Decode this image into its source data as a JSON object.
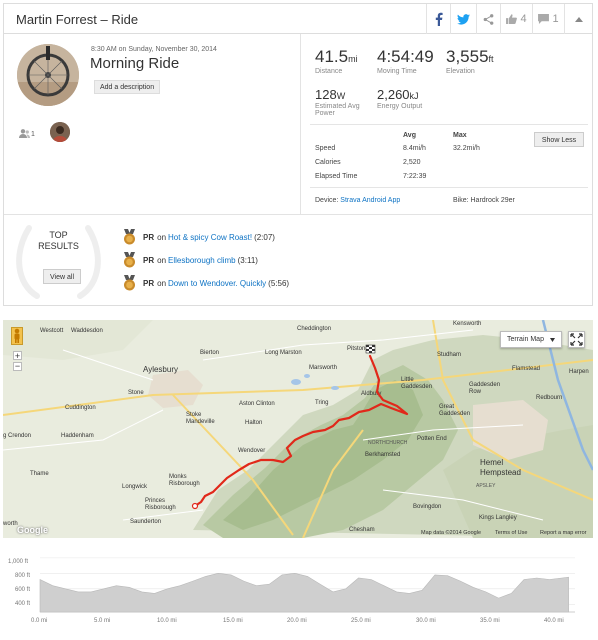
{
  "header": {
    "title": "Martin Forrest – Ride",
    "likes": "4",
    "comments": "1"
  },
  "activity": {
    "date": "8:30 AM on Sunday, November 30, 2014",
    "name": "Morning Ride",
    "add_description": "Add a description",
    "athlete_count": "1"
  },
  "stats": {
    "distance_value": "41.5",
    "distance_unit": "mi",
    "distance_label": "Distance",
    "moving_time_value": "4:54:49",
    "moving_time_label": "Moving Time",
    "elevation_value": "3,555",
    "elevation_unit": "ft",
    "elevation_label": "Elevation",
    "power_value": "128",
    "power_unit": "W",
    "power_label_1": "Estimated Avg",
    "power_label_2": "Power",
    "energy_value": "2,260",
    "energy_unit": "kJ",
    "energy_label": "Energy Output"
  },
  "details": {
    "col_avg": "Avg",
    "col_max": "Max",
    "rows": [
      {
        "label": "Speed",
        "avg": "8.4mi/h",
        "max": "32.2mi/h"
      },
      {
        "label": "Calories",
        "avg": "2,520",
        "max": ""
      },
      {
        "label": "Elapsed Time",
        "avg": "7:22:39",
        "max": ""
      }
    ],
    "show_less": "Show Less",
    "device_label": "Device:",
    "device_value": "Strava Android App",
    "bike": "Bike: Hardrock 29er"
  },
  "top_results": {
    "title_1": "TOP",
    "title_2": "RESULTS",
    "view_all": "View all",
    "items": [
      {
        "pr": "PR",
        "on": "on",
        "segment": "Hot & spicy Cow Roast!",
        "time": "(2:07)"
      },
      {
        "pr": "PR",
        "on": "on",
        "segment": "Ellesborough climb",
        "time": "(3:11)"
      },
      {
        "pr": "PR",
        "on": "on",
        "segment": "Down to Wendover. Quickly",
        "time": "(5:56)"
      }
    ]
  },
  "map": {
    "map_type": "Terrain Map",
    "places": {
      "westcott": "Westcott",
      "waddesdon": "Waddesdon",
      "cheddington": "Cheddington",
      "kensworth": "Kensworth",
      "bierton": "Bierton",
      "long_marston": "Long Marston",
      "pitstone": "Pitstone",
      "studham": "Studham",
      "aylesbury": "Aylesbury",
      "marsworth": "Marsworth",
      "little_gaddesden": "Little Gaddesden",
      "flamstead": "Flamstead",
      "harpenden": "Harpen",
      "stone": "Stone",
      "aston_clinton": "Aston Clinton",
      "tring": "Tring",
      "aldbury": "Aldbury",
      "gaddesden_row": "Gaddesden Row",
      "redbourn": "Redbourn",
      "cuddington": "Cuddington",
      "stoke_mandeville": "Stoke Mandeville",
      "great_gaddesden": "Great Gaddesden",
      "long_crendon": "g Crendon",
      "haddenham": "Haddenham",
      "halton": "Halton",
      "northchurch": "NORTHCHURCH",
      "potten_end": "Potten End",
      "wendover": "Wendover",
      "berkhamsted": "Berkhamsted",
      "hemel": "Hemel Hempstead",
      "thame": "Thame",
      "apsley": "APSLEY",
      "monks_risborough": "Monks Risborough",
      "longwick": "Longwick",
      "princes_risborough": "Princes Risborough",
      "bovingdon": "Bovingdon",
      "saunderton": "Saunderton",
      "chesham": "Chesham",
      "kings_langley": "Kings Langley",
      "tetsworth": "worth"
    },
    "google_logo": "Google",
    "map_data": "Map data ©2014 Google",
    "terms": "Terms of Use",
    "report": "Report a map error"
  },
  "elevation": {
    "y_ticks": [
      "1,000 ft",
      "800 ft",
      "600 ft",
      "400 ft"
    ],
    "x_ticks": [
      "0.0 mi",
      "5.0 mi",
      "10.0 mi",
      "15.0 mi",
      "20.0 mi",
      "25.0 mi",
      "30.0 mi",
      "35.0 mi",
      "40.0 mi"
    ]
  },
  "chart_data": {
    "type": "area",
    "x": [
      0,
      1,
      2,
      3,
      4,
      5,
      6,
      7,
      8,
      9,
      10,
      11,
      12,
      13,
      14,
      15,
      16,
      17,
      18,
      19,
      20,
      21,
      22,
      23,
      24,
      25,
      26,
      27,
      28,
      29,
      30,
      31,
      32,
      33,
      34,
      35,
      36,
      37,
      38,
      39,
      40,
      41.5
    ],
    "values": [
      720,
      640,
      600,
      560,
      560,
      600,
      640,
      620,
      560,
      540,
      600,
      640,
      700,
      760,
      800,
      780,
      700,
      640,
      660,
      780,
      800,
      760,
      660,
      560,
      600,
      740,
      720,
      640,
      560,
      540,
      580,
      780,
      770,
      700,
      620,
      560,
      480,
      540,
      720,
      740,
      720,
      750
    ],
    "ylim": [
      300,
      1050
    ],
    "xlim": [
      0,
      42
    ]
  },
  "colors": {
    "route": "#e1281a",
    "link": "#0e73c4",
    "facebook": "#3b5998",
    "twitter": "#1da1f2",
    "elev_fill": "#cfcfcf"
  }
}
